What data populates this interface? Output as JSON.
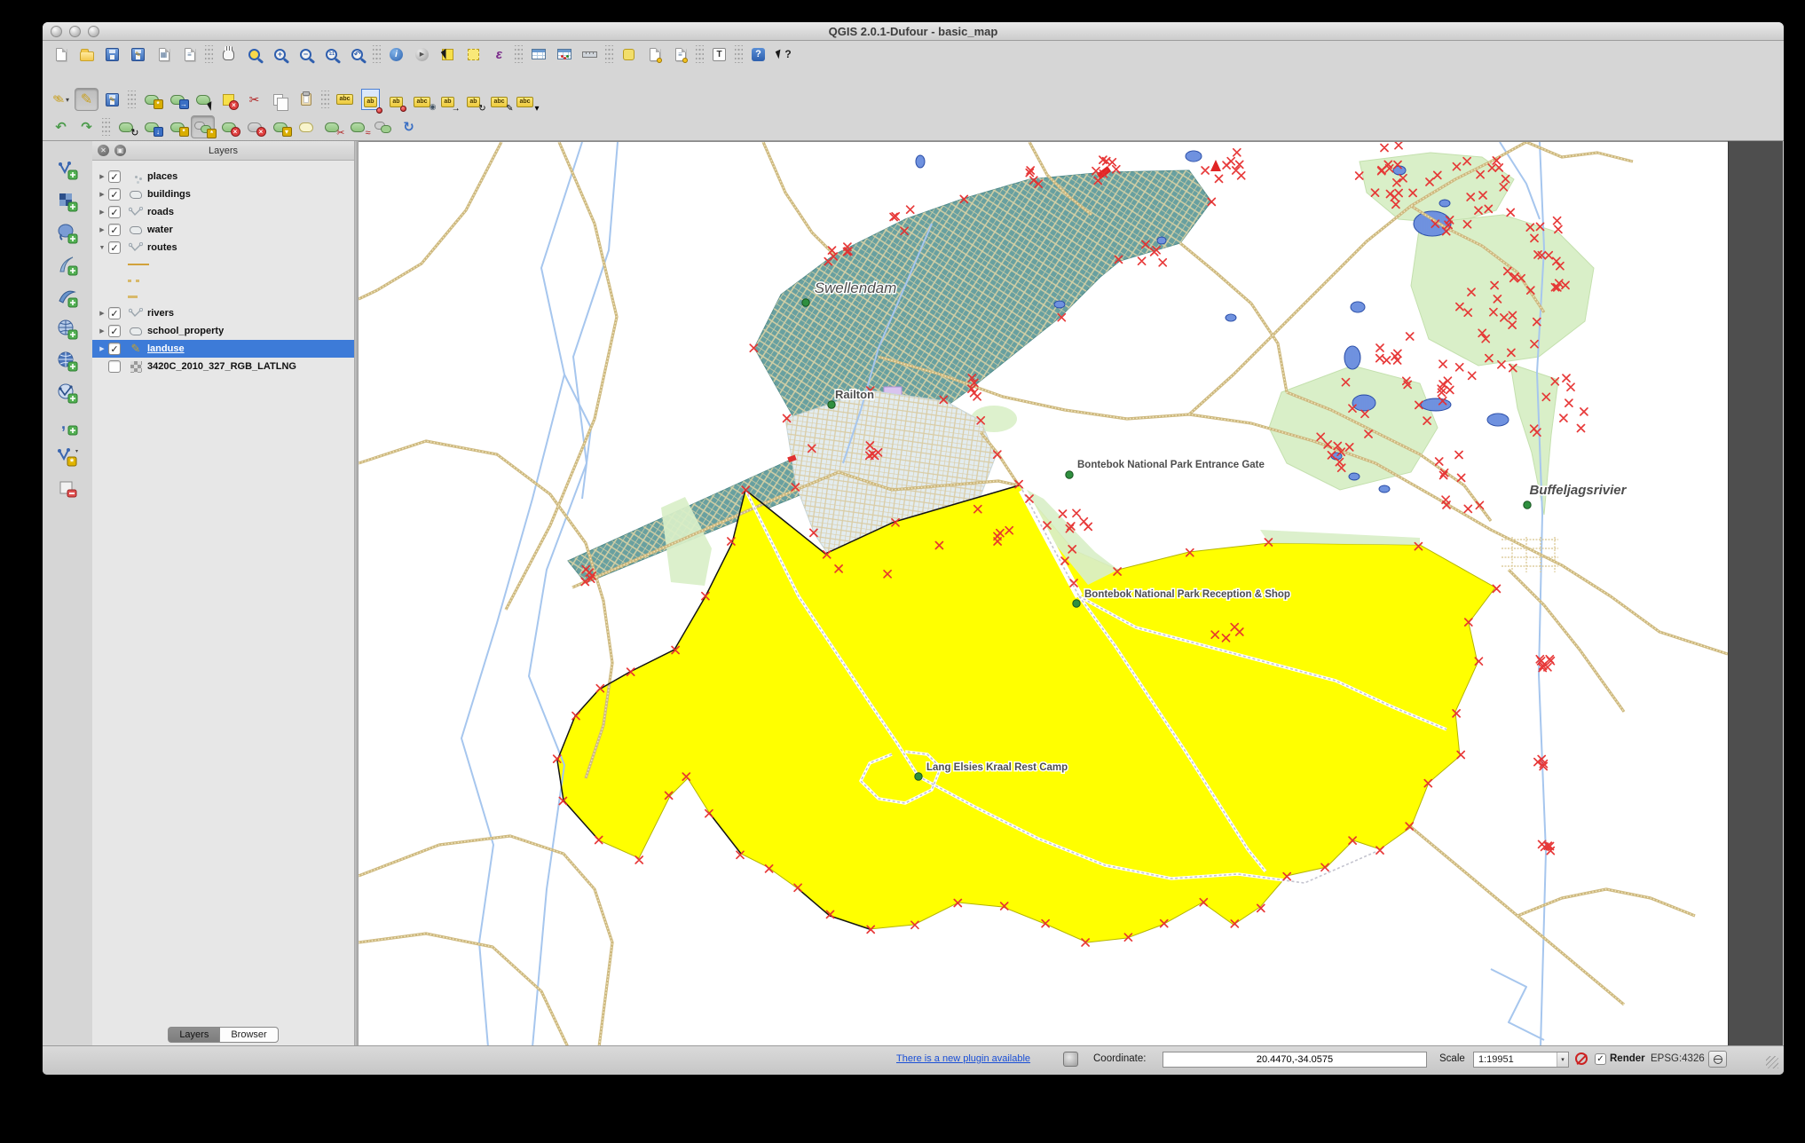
{
  "window": {
    "title": "QGIS 2.0.1-Dufour - basic_map"
  },
  "toolbars": {
    "row1": [
      "new-project",
      "open-project",
      "save-project",
      "save-project-as",
      "new-composer",
      "composer-manager",
      "|",
      "pan-map",
      "zoom-full",
      "zoom-in",
      "zoom-out",
      "zoom-actual",
      "zoom-last",
      "|",
      "identify",
      "run-feature-action",
      "select-features",
      "select-rectangle",
      "select-expression",
      "|",
      "open-attribute-table",
      "field-calculator",
      "measure-line",
      "|",
      "map-tips",
      "new-bookmark",
      "show-bookmarks",
      "|",
      "text-annotation",
      "|",
      "help-contents",
      "whats-this"
    ],
    "row2": [
      "current-edits",
      "toggle-editing",
      "save-layer-edits",
      "|",
      "add-feature",
      "move-feature",
      "node-tool",
      "delete-selected",
      "cut-features",
      "copy-features",
      "paste-features",
      "|",
      "labeling",
      "pin-labels",
      "unpin-labels",
      "show-hide-labels",
      "move-label",
      "rotate-label",
      "change-label-properties",
      "label-settings"
    ],
    "row3": [
      "undo",
      "redo",
      "|",
      "rotate-feature",
      "simplify-feature",
      "add-ring",
      "add-part",
      "delete-ring",
      "delete-part",
      "reshape-features",
      "offset-curve",
      "split-features",
      "split-parts",
      "merge-features",
      "rotate-point-symbols"
    ],
    "left": [
      "add-vector-layer",
      "add-raster-layer",
      "add-postgis-layer",
      "add-spatialite-layer",
      "add-mssql-layer",
      "add-wms-layer",
      "add-wcs-layer",
      "add-wfs-layer",
      "add-delimited-text-layer",
      "new-shapefile-layer",
      "remove-layer"
    ]
  },
  "layers_panel": {
    "title": "Layers",
    "items": [
      {
        "label": "places",
        "checked": true
      },
      {
        "label": "buildings",
        "checked": true
      },
      {
        "label": "roads",
        "checked": true
      },
      {
        "label": "water",
        "checked": true
      },
      {
        "label": "routes",
        "checked": true,
        "expanded": true
      },
      {
        "label": "rivers",
        "checked": true
      },
      {
        "label": "school_property",
        "checked": true
      },
      {
        "label": "landuse",
        "checked": true,
        "selected": true,
        "editing": true
      },
      {
        "label": "3420C_2010_327_RGB_LATLNG",
        "checked": false
      }
    ],
    "tabs": [
      "Layers",
      "Browser"
    ]
  },
  "map": {
    "labels": [
      "Swellendam",
      "Railton",
      "Bontebok National Park Entrance Gate",
      "Bontebok National Park Reception & Shop",
      "Lang Elsies Kraal Rest Camp",
      "Buffeljagsrivier"
    ],
    "colors": {
      "landuse_yellow": "#ffff00",
      "urban_teal": "#68a0a0",
      "park_green": "#d9efc8",
      "water_blue": "#5577d0",
      "road_tan": "#cdb87e",
      "marker_red": "#e62e2e",
      "selection_blue": "#3d7bd8"
    }
  },
  "status": {
    "plugin_link": "There is a new plugin available",
    "coordinate_label": "Coordinate:",
    "coordinate_value": "20.4470,-34.0575",
    "scale_label": "Scale",
    "scale_value": "1:19951",
    "render_label": "Render",
    "crs": "EPSG:4326"
  }
}
